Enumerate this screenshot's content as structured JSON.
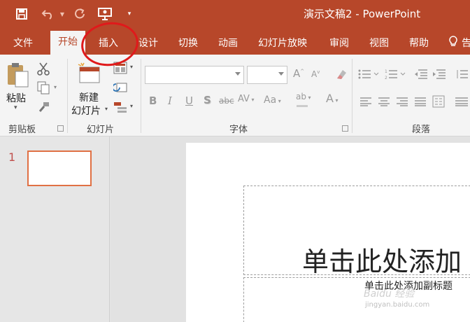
{
  "window": {
    "title": "演示文稿2 - PowerPoint"
  },
  "qat": {
    "icons": [
      "save-icon",
      "undo-icon",
      "redo-icon",
      "present-icon",
      "customize-qat-icon"
    ]
  },
  "tabs": [
    "文件",
    "开始",
    "插入",
    "设计",
    "切换",
    "动画",
    "幻灯片放映",
    "审阅",
    "视图",
    "帮助",
    "告"
  ],
  "active_tab": "开始",
  "ribbon": {
    "clipboard": {
      "group": "剪贴板",
      "paste": "粘贴"
    },
    "slides": {
      "group": "幻灯片",
      "new_slide_line1": "新建",
      "new_slide_line2": "幻灯片"
    },
    "font": {
      "group": "字体",
      "font_name": "",
      "font_size": "",
      "buttons": {
        "bold": "B",
        "italic": "I",
        "underline": "U",
        "shadow": "S",
        "strike": "abc",
        "spacing": "AV",
        "case": "Aa",
        "grow": "A",
        "shrink": "A",
        "highlight": "ab",
        "color": "A"
      }
    },
    "paragraph": {
      "group": "段落"
    }
  },
  "thumbnails": [
    {
      "number": "1"
    }
  ],
  "slide": {
    "title_placeholder": "单击此处添加",
    "subtitle_placeholder": "单击此处添加副标题"
  },
  "watermark": {
    "text": "Baidu 经验",
    "url": "jingyan.baidu.com"
  },
  "colors": {
    "accent": "#b7472a",
    "annotation": "#e0191b",
    "thumb_border": "#e07044"
  }
}
